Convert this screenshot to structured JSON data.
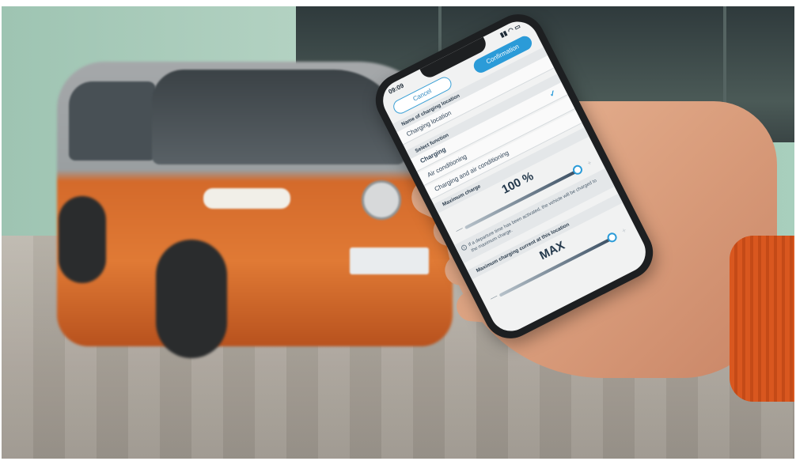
{
  "phone": {
    "status_time": "09:09",
    "status_icons": "▮▮ ◠ ▭",
    "cancel_label": "Cancel",
    "confirm_label": "Confirmation",
    "name_header": "Name of charging location",
    "location_name": "Charging location",
    "function_header": "Select function",
    "functions": [
      "Charging",
      "Air conditioning",
      "Charging and air conditioning"
    ],
    "selected_function": "Charging",
    "max_charge_header": "Maximum charge",
    "max_charge_value": "100 %",
    "max_charge_fraction": 1.0,
    "note_text": "If a departure time has been activated, the vehicle will be charged to the maximum charge.",
    "max_current_header": "Maximum charging current at this location",
    "max_current_value": "MAX",
    "max_current_fraction": 1.0,
    "accent_color": "#2b9bd8",
    "check_icon": "checkmark-icon",
    "info_icon": "info-icon"
  },
  "scene": {
    "vehicle_color": "#d46a2b",
    "background_color": "#a9c9b9"
  }
}
